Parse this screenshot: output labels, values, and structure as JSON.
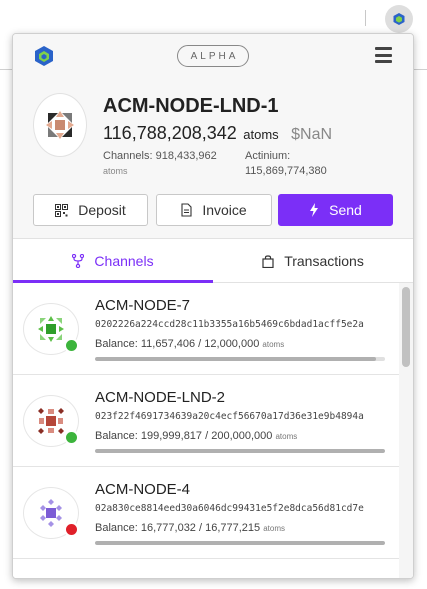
{
  "header": {
    "alpha_label": "ALPHA"
  },
  "account": {
    "node_name": "ACM-NODE-LND-1",
    "balance": "116,788,208,342",
    "balance_unit": "atoms",
    "fiat": "$NaN",
    "channels_label": "Channels:",
    "channels_value": "918,433,962",
    "channels_unit": "atoms",
    "chain_label": "Actinium:",
    "chain_value": "115,869,774,380",
    "chain_unit": "atoms"
  },
  "actions": {
    "deposit": "Deposit",
    "invoice": "Invoice",
    "send": "Send"
  },
  "tabs": {
    "channels": "Channels",
    "transactions": "Transactions"
  },
  "channels": [
    {
      "name": "ACM-NODE-7",
      "pubkey": "0202226a224ccd28c11b3355a16b5469c6bdad1acff5e2a",
      "balance_label": "Balance:",
      "balance": "11,657,406 / 12,000,000",
      "unit": "atoms",
      "fill_fraction": 0.97,
      "status": "online",
      "status_color": "#3cb43c",
      "avatar_color": "#4fbf3c"
    },
    {
      "name": "ACM-NODE-LND-2",
      "pubkey": "023f22f4691734639a20c4ecf56670a17d36e31e9b4894a",
      "balance_label": "Balance:",
      "balance": "199,999,817 / 200,000,000",
      "unit": "atoms",
      "fill_fraction": 1.0,
      "status": "online",
      "status_color": "#3cb43c",
      "avatar_color": "#b5473a"
    },
    {
      "name": "ACM-NODE-4",
      "pubkey": "02a830ce8814eed30a6046dc99431e5f2e8dca56d81cd7e",
      "balance_label": "Balance:",
      "balance": "16,777,032 / 16,777,215",
      "unit": "atoms",
      "fill_fraction": 1.0,
      "status": "offline",
      "status_color": "#e0202a",
      "avatar_color": "#7c5cd6"
    }
  ],
  "colors": {
    "accent": "#7b2ff7"
  }
}
